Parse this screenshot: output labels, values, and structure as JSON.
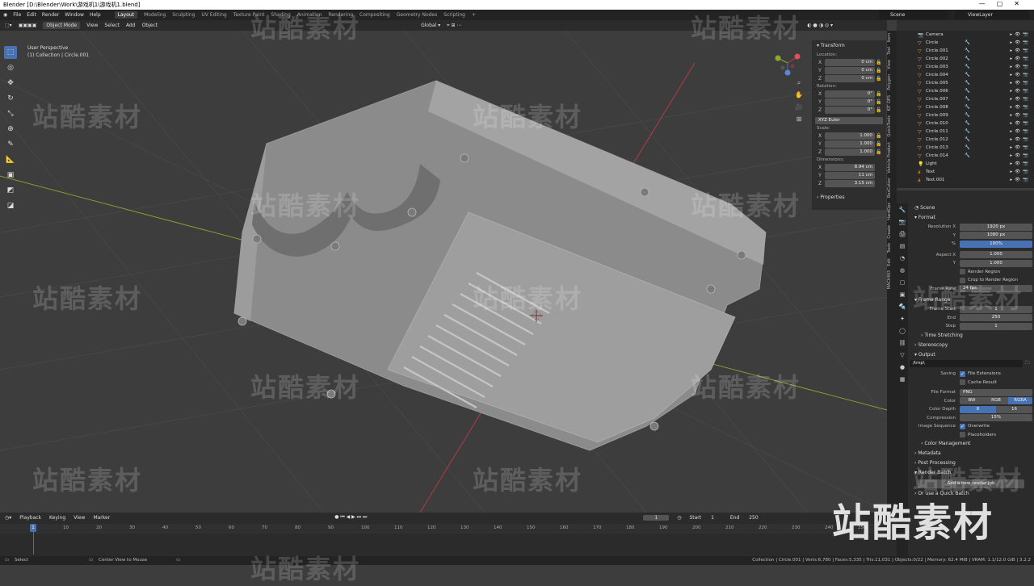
{
  "titlebar": {
    "title": "Blender [D:\\Blender\\Work\\游戏机1\\游戏机1.blend]"
  },
  "menu": {
    "items": [
      "File",
      "Edit",
      "Render",
      "Window",
      "Help"
    ]
  },
  "workspaces": [
    {
      "label": "Layout",
      "active": true
    },
    {
      "label": "Modeling",
      "active": false
    },
    {
      "label": "Sculpting",
      "active": false
    },
    {
      "label": "UV Editing",
      "active": false
    },
    {
      "label": "Texture Paint",
      "active": false
    },
    {
      "label": "Shading",
      "active": false
    },
    {
      "label": "Animation",
      "active": false
    },
    {
      "label": "Rendering",
      "active": false
    },
    {
      "label": "Compositing",
      "active": false
    },
    {
      "label": "Geometry Nodes",
      "active": false
    },
    {
      "label": "Scripting",
      "active": false
    }
  ],
  "scene_selector": "Scene",
  "viewlayer_selector": "ViewLayer",
  "viewport_header": {
    "mode": "Object Mode",
    "menus": [
      "View",
      "Select",
      "Add",
      "Object"
    ],
    "orientation": "Global",
    "options": "Options"
  },
  "viewport": {
    "perspective": "User Perspective",
    "collection": "(1) Collection | Circle.001"
  },
  "tools": [
    "select",
    "cursor",
    "move",
    "rotate",
    "scale",
    "transform",
    "annotate",
    "measure",
    "add-cube",
    "shrink",
    "extra"
  ],
  "npanel": {
    "transform_header": "Transform",
    "location_label": "Location:",
    "location": [
      {
        "axis": "X",
        "value": "0 cm"
      },
      {
        "axis": "Y",
        "value": "0 cm"
      },
      {
        "axis": "Z",
        "value": "0 cm"
      }
    ],
    "rotation_label": "Rotation:",
    "rotation": [
      {
        "axis": "X",
        "value": "0°"
      },
      {
        "axis": "Y",
        "value": "0°"
      },
      {
        "axis": "Z",
        "value": "0°"
      }
    ],
    "rotation_mode": "XYZ Euler",
    "scale_label": "Scale:",
    "scale": [
      {
        "axis": "X",
        "value": "1.000"
      },
      {
        "axis": "Y",
        "value": "1.000"
      },
      {
        "axis": "Z",
        "value": "1.000"
      }
    ],
    "dimensions_label": "Dimensions:",
    "dimensions": [
      {
        "axis": "X",
        "value": "8.94 cm"
      },
      {
        "axis": "Y",
        "value": "11 cm"
      },
      {
        "axis": "Z",
        "value": "3.15 cm"
      }
    ],
    "properties_header": "Properties"
  },
  "side_tabs": [
    "Item",
    "Tool",
    "View",
    "Polygon",
    "KIT OPS",
    "QuickTools",
    "Vehicle Product",
    "BoxCutter",
    "HardOps",
    "Create",
    "Tools",
    "Edit",
    "MACHIN3"
  ],
  "outliner": {
    "items": [
      {
        "name": "Camera",
        "icon": "camera"
      },
      {
        "name": "Circle",
        "icon": "mesh"
      },
      {
        "name": "Circle.001",
        "icon": "mesh"
      },
      {
        "name": "Circle.002",
        "icon": "mesh"
      },
      {
        "name": "Circle.003",
        "icon": "mesh"
      },
      {
        "name": "Circle.004",
        "icon": "mesh"
      },
      {
        "name": "Circle.005",
        "icon": "mesh"
      },
      {
        "name": "Circle.006",
        "icon": "mesh"
      },
      {
        "name": "Circle.007",
        "icon": "mesh"
      },
      {
        "name": "Circle.008",
        "icon": "mesh"
      },
      {
        "name": "Circle.009",
        "icon": "mesh"
      },
      {
        "name": "Circle.010",
        "icon": "mesh"
      },
      {
        "name": "Circle.011",
        "icon": "mesh"
      },
      {
        "name": "Circle.012",
        "icon": "mesh"
      },
      {
        "name": "Circle.013",
        "icon": "mesh"
      },
      {
        "name": "Circle.014",
        "icon": "mesh"
      },
      {
        "name": "Light",
        "icon": "light"
      },
      {
        "name": "Text",
        "icon": "text"
      },
      {
        "name": "Text.001",
        "icon": "text"
      }
    ]
  },
  "properties": {
    "scene": "Scene",
    "format_header": "Format",
    "resolution_x_label": "Resolution X",
    "resolution_x": "1920 px",
    "resolution_y_label": "Y",
    "resolution_y": "1080 px",
    "percent_label": "%",
    "percent": "100%",
    "aspect_x_label": "Aspect X",
    "aspect_x": "1.000",
    "aspect_y_label": "Y",
    "aspect_y": "1.000",
    "render_region": "Render Region",
    "crop_region": "Crop to Render Region",
    "frame_rate_label": "Frame Rate",
    "frame_rate": "24 fps",
    "frame_range_header": "Frame Range",
    "frame_start_label": "Frame Start",
    "frame_start": "1",
    "end_label": "End",
    "end": "250",
    "step_label": "Step",
    "step": "1",
    "time_stretching": "Time Stretching",
    "stereoscopy": "Stereoscopy",
    "output_header": "Output",
    "output_path": "/tmp\\",
    "saving_label": "Saving",
    "file_extensions": "File Extensions",
    "cache_result": "Cache Result",
    "file_format_label": "File Format",
    "file_format": "PNG",
    "color_label": "Color",
    "color_options": [
      "BW",
      "RGB",
      "RGBA"
    ],
    "color_depth_label": "Color Depth",
    "color_depth_options": [
      "8",
      "16"
    ],
    "compression_label": "Compression",
    "compression": "15%",
    "image_sequence_label": "Image Sequence",
    "overwrite": "Overwrite",
    "placeholders": "Placeholders",
    "color_management": "Color Management",
    "metadata": "Metadata",
    "post_processing": "Post Processing",
    "render_batch": "Render Batch",
    "add_render_job": "Add a new render job",
    "quick_batch": "Or use a Quick Batch"
  },
  "timeline": {
    "menus": [
      "Playback",
      "Keying",
      "View",
      "Marker"
    ],
    "current_frame": "1",
    "start_label": "Start",
    "start": "1",
    "end_label": "End",
    "end": "250",
    "ticks": [
      "1",
      "10",
      "20",
      "30",
      "40",
      "50",
      "60",
      "70",
      "80",
      "90",
      "100",
      "110",
      "120",
      "130",
      "140",
      "150",
      "160",
      "170",
      "180",
      "190",
      "200",
      "210",
      "220",
      "230",
      "240",
      "250"
    ]
  },
  "statusbar": {
    "left": "Select",
    "middle": "Center View to Mouse",
    "right": "Collection | Circle.001 | Verts:6,780 | Faces:5,335 | Tris:11,031 | Objects:0/22 | Memory: 62.4 MiB | VRAM: 1.1/12.0 GiB | 3.2.2"
  },
  "watermark": "站酷素材",
  "colors": {
    "accent": "#4772b3",
    "background": "#3d3d3d",
    "panel": "#2b2b2b",
    "axis_x": "#c0394a",
    "axis_y": "#8aab2e"
  }
}
